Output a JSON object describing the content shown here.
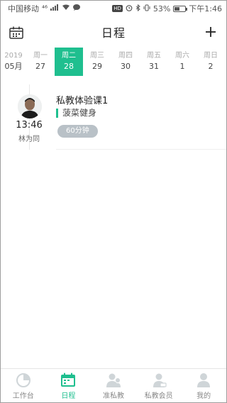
{
  "status_bar": {
    "carrier": "中国移动",
    "signal": "⁴⁶",
    "battery_percent": "53%",
    "battery_level": 0.53,
    "time": "下午1:46"
  },
  "header": {
    "title": "日程",
    "calendar_icon": "calendar-icon",
    "add_icon": "plus-icon"
  },
  "week": {
    "year": "2019",
    "month": "05月",
    "days": [
      {
        "name": "周一",
        "date": "27",
        "active": false
      },
      {
        "name": "周二",
        "date": "28",
        "active": true
      },
      {
        "name": "周三",
        "date": "29",
        "active": false
      },
      {
        "name": "周四",
        "date": "30",
        "active": false
      },
      {
        "name": "周五",
        "date": "31",
        "active": false
      },
      {
        "name": "周六",
        "date": "1",
        "active": false
      },
      {
        "name": "周日",
        "date": "2",
        "active": false
      }
    ]
  },
  "schedule": [
    {
      "time": "13:46",
      "coach": "林为同",
      "course": "私教体验课1",
      "venue": "菠菜健身",
      "duration": "60分钟"
    }
  ],
  "tabbar": {
    "items": [
      {
        "label": "工作台",
        "icon": "workbench-icon",
        "active": false
      },
      {
        "label": "日程",
        "icon": "calendar-icon",
        "active": true
      },
      {
        "label": "准私教",
        "icon": "prospect-members-icon",
        "active": false
      },
      {
        "label": "私教会员",
        "icon": "members-icon",
        "active": false
      },
      {
        "label": "我的",
        "icon": "profile-icon",
        "active": false
      }
    ]
  },
  "colors": {
    "accent": "#1fbf8f",
    "tag": "#b9c1c7",
    "inactive_icon": "#cfd5d8"
  }
}
